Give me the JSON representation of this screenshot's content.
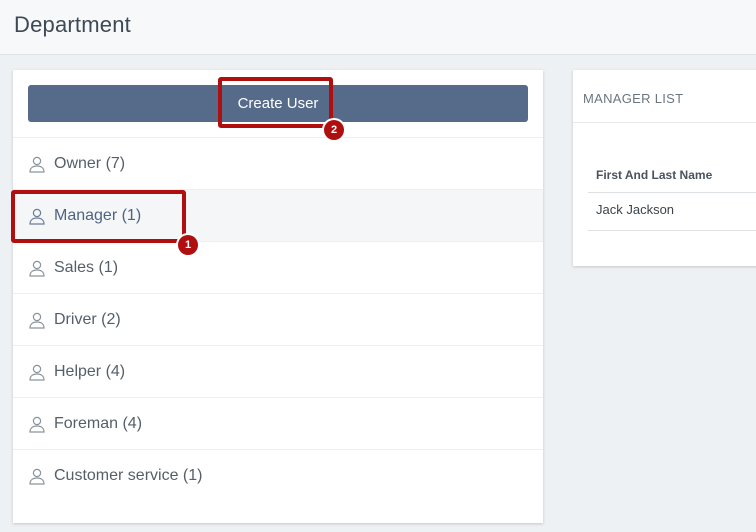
{
  "header": {
    "title": "Department"
  },
  "left_panel": {
    "create_button_label": "Create User",
    "roles": [
      {
        "label": "Owner (7)",
        "active": false
      },
      {
        "label": "Manager (1)",
        "active": true
      },
      {
        "label": "Sales (1)",
        "active": false
      },
      {
        "label": "Driver (2)",
        "active": false
      },
      {
        "label": "Helper (4)",
        "active": false
      },
      {
        "label": "Foreman (4)",
        "active": false
      },
      {
        "label": "Customer service (1)",
        "active": false
      }
    ]
  },
  "right_panel": {
    "title": "MANAGER LIST",
    "table": {
      "columns": [
        "First And Last Name"
      ],
      "rows": [
        [
          "Jack Jackson"
        ]
      ]
    }
  },
  "annotations": [
    {
      "number": "1"
    },
    {
      "number": "2"
    }
  ],
  "colors": {
    "accent": "#566a8a",
    "annotation": "#b00f10"
  },
  "icons": {
    "role_icon": "user-outline-icon"
  }
}
